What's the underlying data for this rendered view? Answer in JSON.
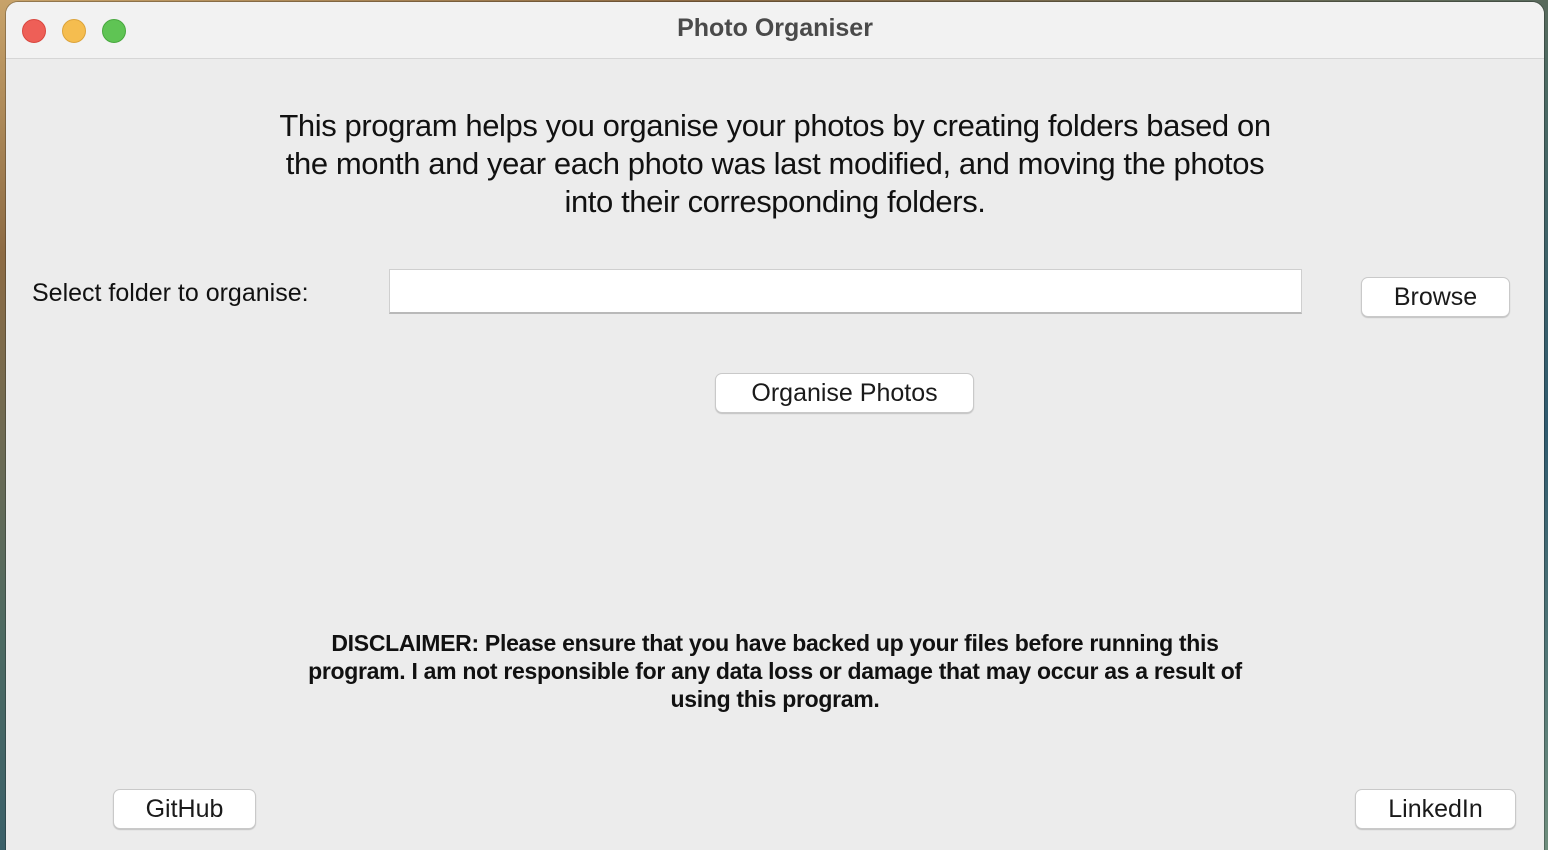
{
  "window": {
    "title": "Photo Organiser"
  },
  "intro": {
    "lines": [
      "This program helps you organise your photos by creating folders based on",
      "the month and year each photo was last modified, and moving the photos",
      "into their corresponding folders."
    ]
  },
  "folder_select": {
    "label": "Select folder to organise:",
    "value": "",
    "placeholder": "",
    "browse_label": "Browse"
  },
  "actions": {
    "organise_label": "Organise Photos"
  },
  "disclaimer": {
    "lines": [
      "DISCLAIMER: Please ensure that you have backed up your files before running this",
      "program. I am not responsible for any data loss or damage that may occur as a result of",
      "using this program."
    ]
  },
  "footer": {
    "github_label": "GitHub",
    "linkedin_label": "LinkedIn"
  },
  "colors": {
    "close": "#ee5f57",
    "minimize": "#f5bd4f",
    "zoom": "#5fc454",
    "window_bg": "#ececec"
  }
}
